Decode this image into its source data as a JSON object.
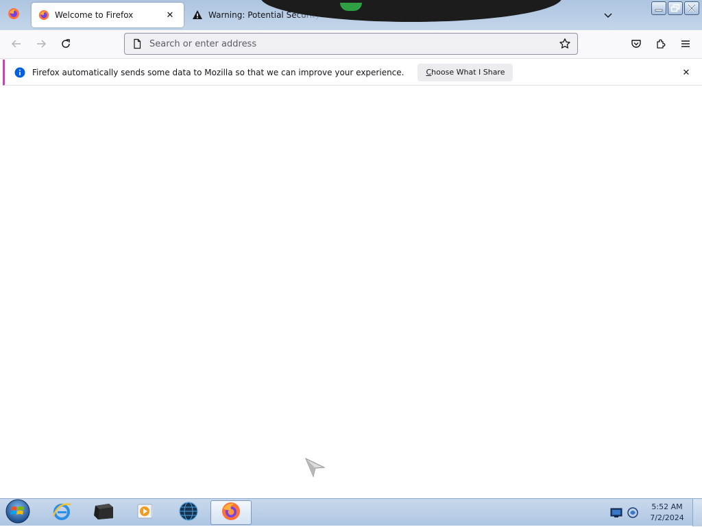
{
  "tabs": [
    {
      "title": "Welcome to Firefox",
      "icon": "firefox-icon",
      "close": "✕"
    },
    {
      "title": "Warning: Potential Security Risk Ahead",
      "icon": "warning-icon"
    }
  ],
  "urlbar": {
    "placeholder": "Search or enter address"
  },
  "notification": {
    "text": "Firefox automatically sends some data to Mozilla so that we can improve your experience.",
    "button_accesskey": "C",
    "button_rest": "hoose What I Share",
    "close": "✕",
    "accent_color": "#c446b6",
    "icon": "info-icon"
  },
  "taskbar": {
    "items": [
      "start-orb-icon",
      "internet-explorer-icon",
      "explorer-icon",
      "media-player-icon",
      "network-globe-icon",
      "firefox-icon"
    ],
    "clock": {
      "time": "5:52 AM",
      "date": "7/2/2024"
    }
  },
  "colors": {
    "firefox_orange": "#ff7139",
    "firefox_purple": "#7542e5",
    "info_blue": "#0060df"
  }
}
